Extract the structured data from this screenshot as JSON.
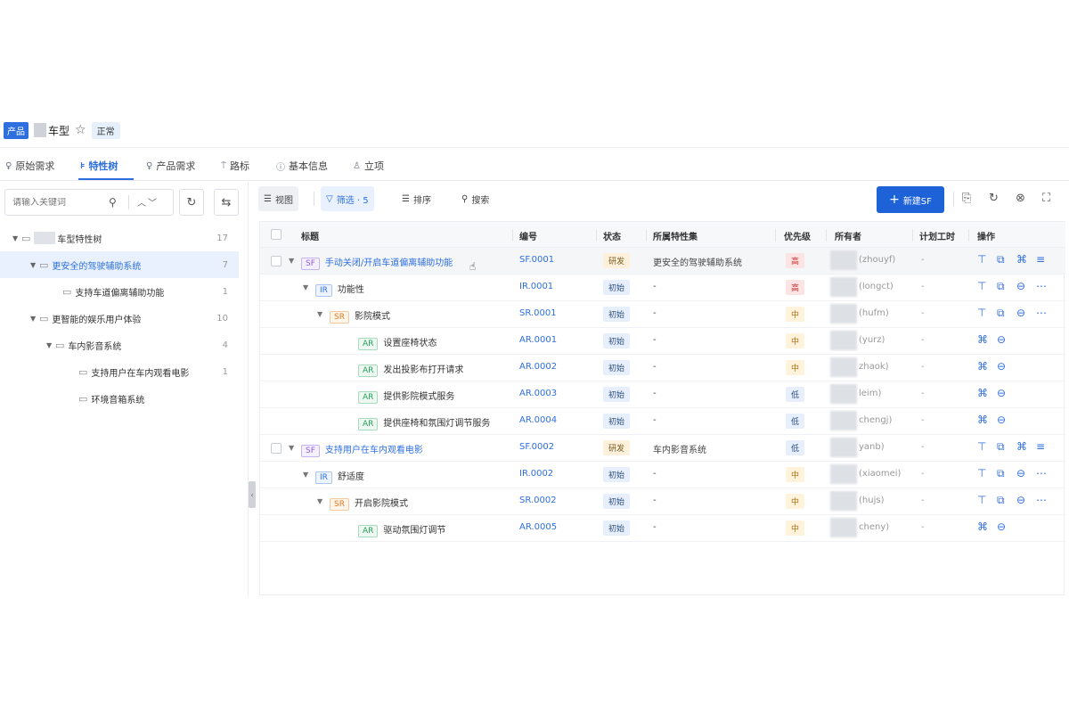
{
  "header": {
    "product_tag": "产品",
    "title": "车型",
    "status": "正常"
  },
  "tabs": [
    {
      "label": "原始需求",
      "icon": "bulb-icon"
    },
    {
      "label": "特性树",
      "icon": "tree-icon",
      "active": true
    },
    {
      "label": "产品需求",
      "icon": "bulb-icon"
    },
    {
      "label": "路标",
      "icon": "signpost-icon"
    },
    {
      "label": "基本信息",
      "icon": "info-icon"
    },
    {
      "label": "立项",
      "icon": "project-icon"
    }
  ],
  "sidebar": {
    "search_placeholder": "请输入关键词",
    "tree": [
      {
        "label": "车型特性树",
        "count": "17"
      },
      {
        "label": "更安全的驾驶辅助系统",
        "count": "7"
      },
      {
        "label": "支持车道偏离辅助功能",
        "count": "1"
      },
      {
        "label": "更智能的娱乐用户体验",
        "count": "10"
      },
      {
        "label": "车内影音系统",
        "count": "4"
      },
      {
        "label": "支持用户在车内观看电影",
        "count": "1"
      },
      {
        "label": "环境音箱系统",
        "count": ""
      }
    ]
  },
  "toolbar": {
    "view_label": "视图",
    "filter_label": "筛选 · 5",
    "sort_label": "排序",
    "search_label": "搜索",
    "new_button": "新建SF"
  },
  "table": {
    "headers": [
      "标题",
      "编号",
      "状态",
      "所属特性集",
      "优先级",
      "所有者",
      "计划工时",
      "操作"
    ],
    "rows": [
      {
        "type": "SF",
        "title": "手动关闭/开启车道偏离辅助功能",
        "code": "SF.0001",
        "state": "研发",
        "feature_set": "更安全的驾驶辅助系统",
        "priority": "高",
        "owner": "(zhouyf)",
        "hours": "-"
      },
      {
        "type": "IR",
        "title": "功能性",
        "code": "IR.0001",
        "state": "初始",
        "feature_set": "-",
        "priority": "高",
        "owner": "(longct)",
        "hours": "-"
      },
      {
        "type": "SR",
        "title": "影院模式",
        "code": "SR.0001",
        "state": "初始",
        "feature_set": "-",
        "priority": "中",
        "owner": "(hufm)",
        "hours": "-"
      },
      {
        "type": "AR",
        "title": "设置座椅状态",
        "code": "AR.0001",
        "state": "初始",
        "feature_set": "-",
        "priority": "中",
        "owner": "(yurz)",
        "hours": "-"
      },
      {
        "type": "AR",
        "title": "发出投影布打开请求",
        "code": "AR.0002",
        "state": "初始",
        "feature_set": "-",
        "priority": "中",
        "owner": "zhaok)",
        "hours": "-"
      },
      {
        "type": "AR",
        "title": "提供影院模式服务",
        "code": "AR.0003",
        "state": "初始",
        "feature_set": "-",
        "priority": "低",
        "owner": "leim)",
        "hours": "-"
      },
      {
        "type": "AR",
        "title": "提供座椅和氛围灯调节服务",
        "code": "AR.0004",
        "state": "初始",
        "feature_set": "-",
        "priority": "低",
        "owner": "chengj)",
        "hours": "-"
      },
      {
        "type": "SF",
        "title": "支持用户在车内观看电影",
        "code": "SF.0002",
        "state": "研发",
        "feature_set": "车内影音系统",
        "priority": "低",
        "owner": "yanb)",
        "hours": "-"
      },
      {
        "type": "IR",
        "title": "舒适度",
        "code": "IR.0002",
        "state": "初始",
        "feature_set": "-",
        "priority": "中",
        "owner": "(xiaomei)",
        "hours": "-"
      },
      {
        "type": "SR",
        "title": "开启影院模式",
        "code": "SR.0002",
        "state": "初始",
        "feature_set": "-",
        "priority": "中",
        "owner": "(hujs)",
        "hours": "-"
      },
      {
        "type": "AR",
        "title": "驱动氛围灯调节",
        "code": "AR.0005",
        "state": "初始",
        "feature_set": "-",
        "priority": "中",
        "owner": "cheny)",
        "hours": "-"
      }
    ]
  },
  "colors": {
    "accent": "#2e6fe0",
    "primary_button": "#1e62d8",
    "selected_bg": "#e8f1fd"
  }
}
